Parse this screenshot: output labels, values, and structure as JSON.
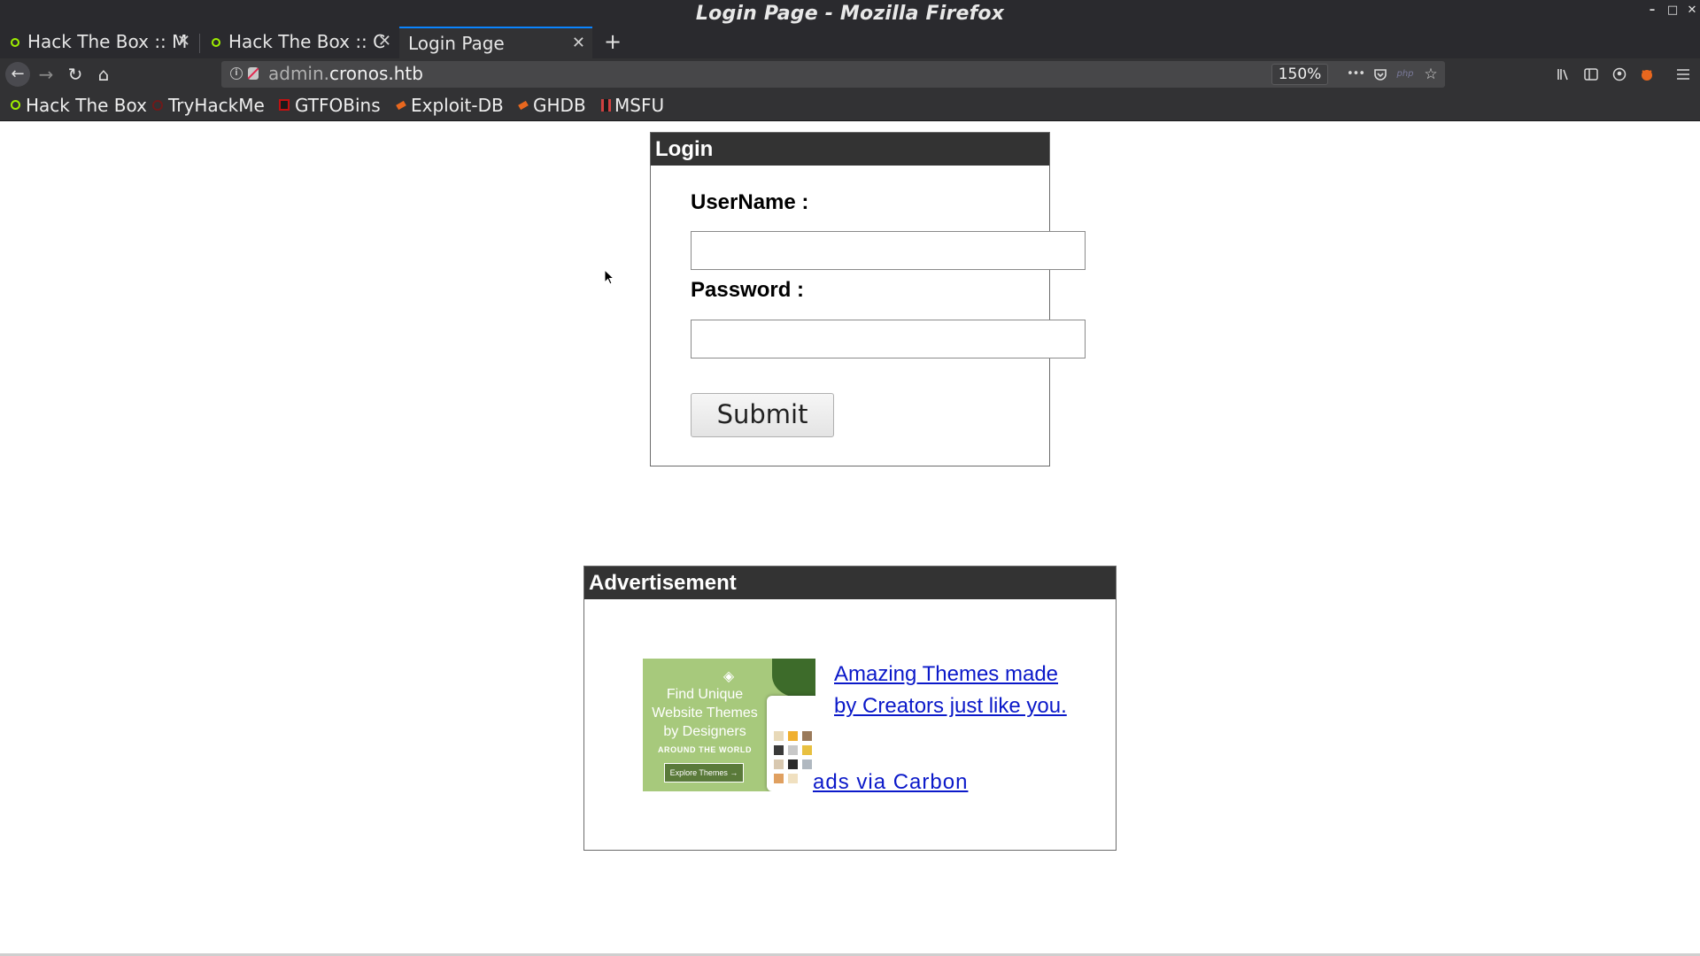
{
  "window": {
    "title": "Login Page - Mozilla Firefox",
    "controls": {
      "minimize": "–",
      "maximize": "□",
      "close": "✕"
    }
  },
  "tabs": [
    {
      "label": "Hack The Box :: M",
      "favicon": "hackthebox-icon",
      "close": "✕",
      "active": false
    },
    {
      "label": "Hack The Box :: C",
      "favicon": "hackthebox-icon",
      "close": "✕",
      "active": false
    },
    {
      "label": "Login Page",
      "close": "✕",
      "active": true
    }
  ],
  "new_tab_label": "+",
  "navigation": {
    "back": "←",
    "forward": "→",
    "reload": "↻",
    "home": "⌂",
    "url_subdomain": "admin.",
    "url_domain": "cronos.htb",
    "zoom": "150%",
    "page_actions": "•••"
  },
  "bookmarks": [
    {
      "label": "Hack The Box",
      "icon": "hackthebox-icon",
      "color": "#9fef00"
    },
    {
      "label": "TryHackMe",
      "icon": "tryhackme-icon",
      "color": "#c11111"
    },
    {
      "label": "GTFOBins",
      "icon": "gtfobins-icon",
      "color": "#c11111"
    },
    {
      "label": "Exploit-DB",
      "icon": "exploitdb-icon",
      "color": "#e8671e"
    },
    {
      "label": "GHDB",
      "icon": "ghdb-icon",
      "color": "#e8671e"
    },
    {
      "label": "MSFU",
      "icon": "msfu-icon",
      "color": "#d04040"
    }
  ],
  "login": {
    "header": "Login",
    "username_label": "UserName :",
    "username_value": "",
    "password_label": "Password :",
    "password_value": "",
    "submit_label": "Submit"
  },
  "advertisement": {
    "header": "Advertisement",
    "image_text": "Find Unique Website Themes by Designers",
    "image_subtext": "AROUND THE WORLD",
    "image_cta": "Explore Themes →",
    "link_text": "Amazing Themes made by Creators just like you.",
    "carbon_text": "ads via Carbon"
  },
  "colors": {
    "chrome_bg": "#2a2a2e",
    "toolbar_bg": "#323234",
    "accent_tab": "#0a84ff",
    "panel_header": "#333333",
    "link": "#0b19c9"
  }
}
